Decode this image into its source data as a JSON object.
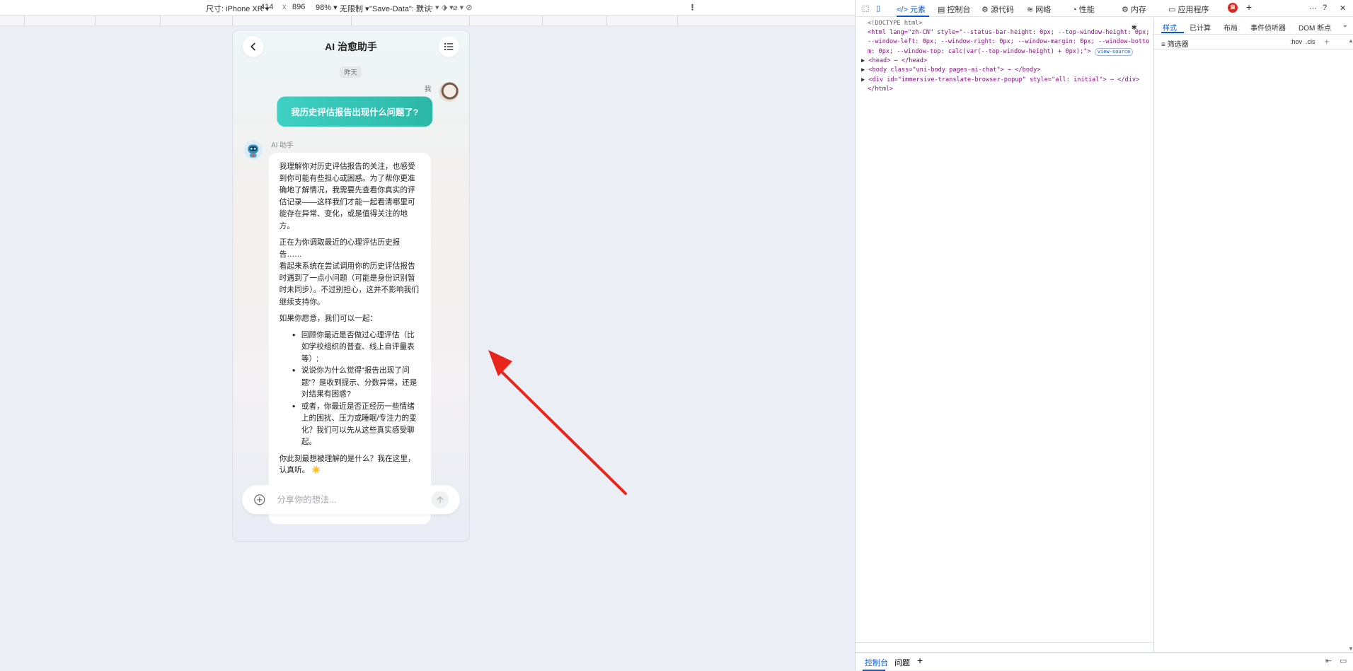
{
  "device_toolbar": {
    "dimensions_label": "尺寸: iPhone XR ▾",
    "width": "414",
    "times": "x",
    "height": "896",
    "zoom": "98% ▾",
    "throttle": "无限制 ▾",
    "save_data": "\"Save-Data\": 默认",
    "more": "⋮"
  },
  "app": {
    "title": "AI 治愈助手",
    "date_divider": "昨天",
    "user_label": "我",
    "user_message": "我历史评估报告出现什么问题了?",
    "ai_label": "AI 助手",
    "ai_paragraphs": [
      "我理解你对历史评估报告的关注，也感受到你可能有些担心或困惑。为了帮你更准确地了解情况，我需要先查看你真实的评估记录——这样我们才能一起看清哪里可能存在异常、变化，或是值得关注的地方。",
      "正在为你调取最近的心理评估历史报告……",
      "看起来系统在尝试调用你的历史评估报告时遇到了一点小问题（可能是身份识别暂时未同步）。不过别担心，这并不影响我们继续支持你。",
      "如果你愿意，我们可以一起："
    ],
    "ai_list": [
      "回顾你最近是否做过心理评估（比如学校组织的普查、线上自评量表等）;",
      "说说你为什么觉得“报告出现了问题”？是收到提示、分数异常，还是对结果有困惑?",
      "或者，你最近是否正经历一些情绪上的困扰、压力或睡眠/专注力的变化？我们可以先从这些真实感受聊起。"
    ],
    "ai_closing": "你此刻最想被理解的是什么？我在这里，认真听。",
    "ai_emoji": "☀️",
    "input_placeholder": "分享你的想法..."
  },
  "devtools": {
    "tabs": [
      "元素",
      "控制台",
      "源代码",
      "网络",
      "性能",
      "内存",
      "应用程序"
    ],
    "code_lines": {
      "doctype": "<!DOCTYPE html>",
      "html_open": "<html lang=\"zh-CN\" style=\"--status-bar-height: 0px; --top-window-height: 0px; --window-left: 0px; --window-right: 0px; --window-margin: 0px; --window-bottom: 0px; --window-top: calc(var(--top-window-height) + 0px);\">",
      "view_source": "view-source",
      "head": "<head> ⋯ </head>",
      "body": "<body class=\"uni-body pages-ai-chat\"> ⋯ </body>",
      "div": "<div id=\"immersive-translate-browser-popup\" style=\"all: initial\"> ⋯ </div>",
      "html_close": "</html>"
    },
    "style_tabs": [
      "样式",
      "已计算",
      "布局",
      "事件侦听器",
      "DOM 断点"
    ],
    "filter_placeholder": "筛选器",
    "hov": ":hov",
    "cls": ".cls",
    "drawer_tabs": [
      "控制台",
      "问题"
    ]
  },
  "colors": {
    "accent": "#2bb8a8",
    "devtools_blue": "#0b57d0",
    "annotation_arrow": "#e8241c"
  }
}
